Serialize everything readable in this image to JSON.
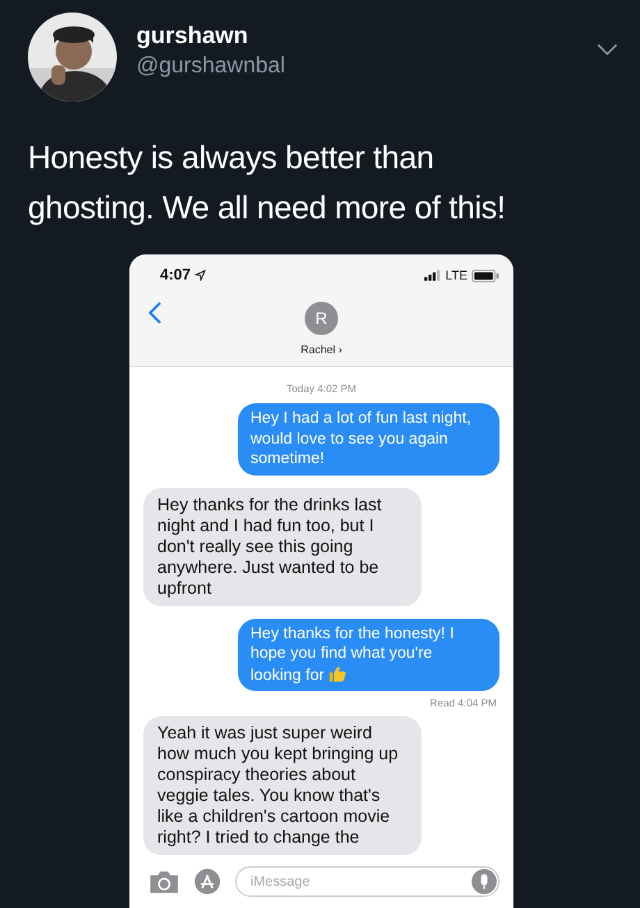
{
  "tweet": {
    "name": "gurshawn",
    "handle": "@gurshawnbal",
    "text": "Honesty is always better than ghosting. We all need more of this!"
  },
  "phone": {
    "status_bar": {
      "time": "4:07",
      "network": "LTE"
    },
    "contact": {
      "initial": "R",
      "name": "Rachel ›"
    },
    "timestamp": "Today 4:02 PM",
    "messages": [
      {
        "kind": "sent",
        "text": "Hey I had a lot of fun last night, would love to see you again sometime!",
        "thumbs_up": false
      },
      {
        "kind": "received",
        "text": "Hey thanks for the drinks last night and I had fun too, but I don't really see this going anywhere. Just wanted to be upfront",
        "thumbs_up": false
      },
      {
        "kind": "sent",
        "text": "Hey thanks for the honesty! I hope you find what you're looking for",
        "thumbs_up": true
      },
      {
        "kind": "receipt",
        "text": "Read 4:04 PM"
      },
      {
        "kind": "received",
        "text": "Yeah it was just super weird how much you kept bringing up conspiracy theories about veggie tales. You know that's like a children's cartoon movie right? I tried to change the",
        "thumbs_up": false
      }
    ],
    "input": {
      "placeholder": "iMessage"
    }
  }
}
